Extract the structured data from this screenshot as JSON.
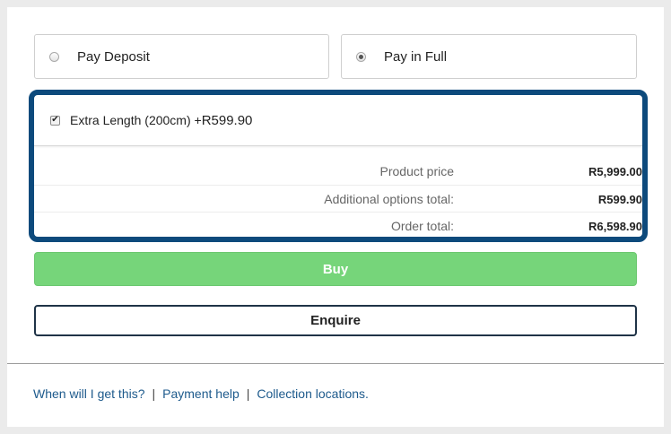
{
  "payment_options": {
    "deposit": {
      "label": "Pay Deposit",
      "selected": false
    },
    "full": {
      "label": "Pay in Full",
      "selected": true
    }
  },
  "extra_option": {
    "label": "Extra Length (200cm) + ",
    "price": "R599.90",
    "checked": true
  },
  "summary": {
    "rows": [
      {
        "label": "Product price",
        "value": "R5,999.00"
      },
      {
        "label": "Additional options total:",
        "value": "R599.90"
      },
      {
        "label": "Order total:",
        "value": "R6,598.90"
      }
    ]
  },
  "buttons": {
    "buy": "Buy",
    "enquire": "Enquire"
  },
  "footer": {
    "links": [
      "When will I get this?",
      "Payment help",
      "Collection locations."
    ],
    "separator": "|"
  },
  "colors": {
    "highlight_border": "#0d4a7c",
    "buy_button": "#76d57a",
    "link": "#1d5a8c"
  }
}
